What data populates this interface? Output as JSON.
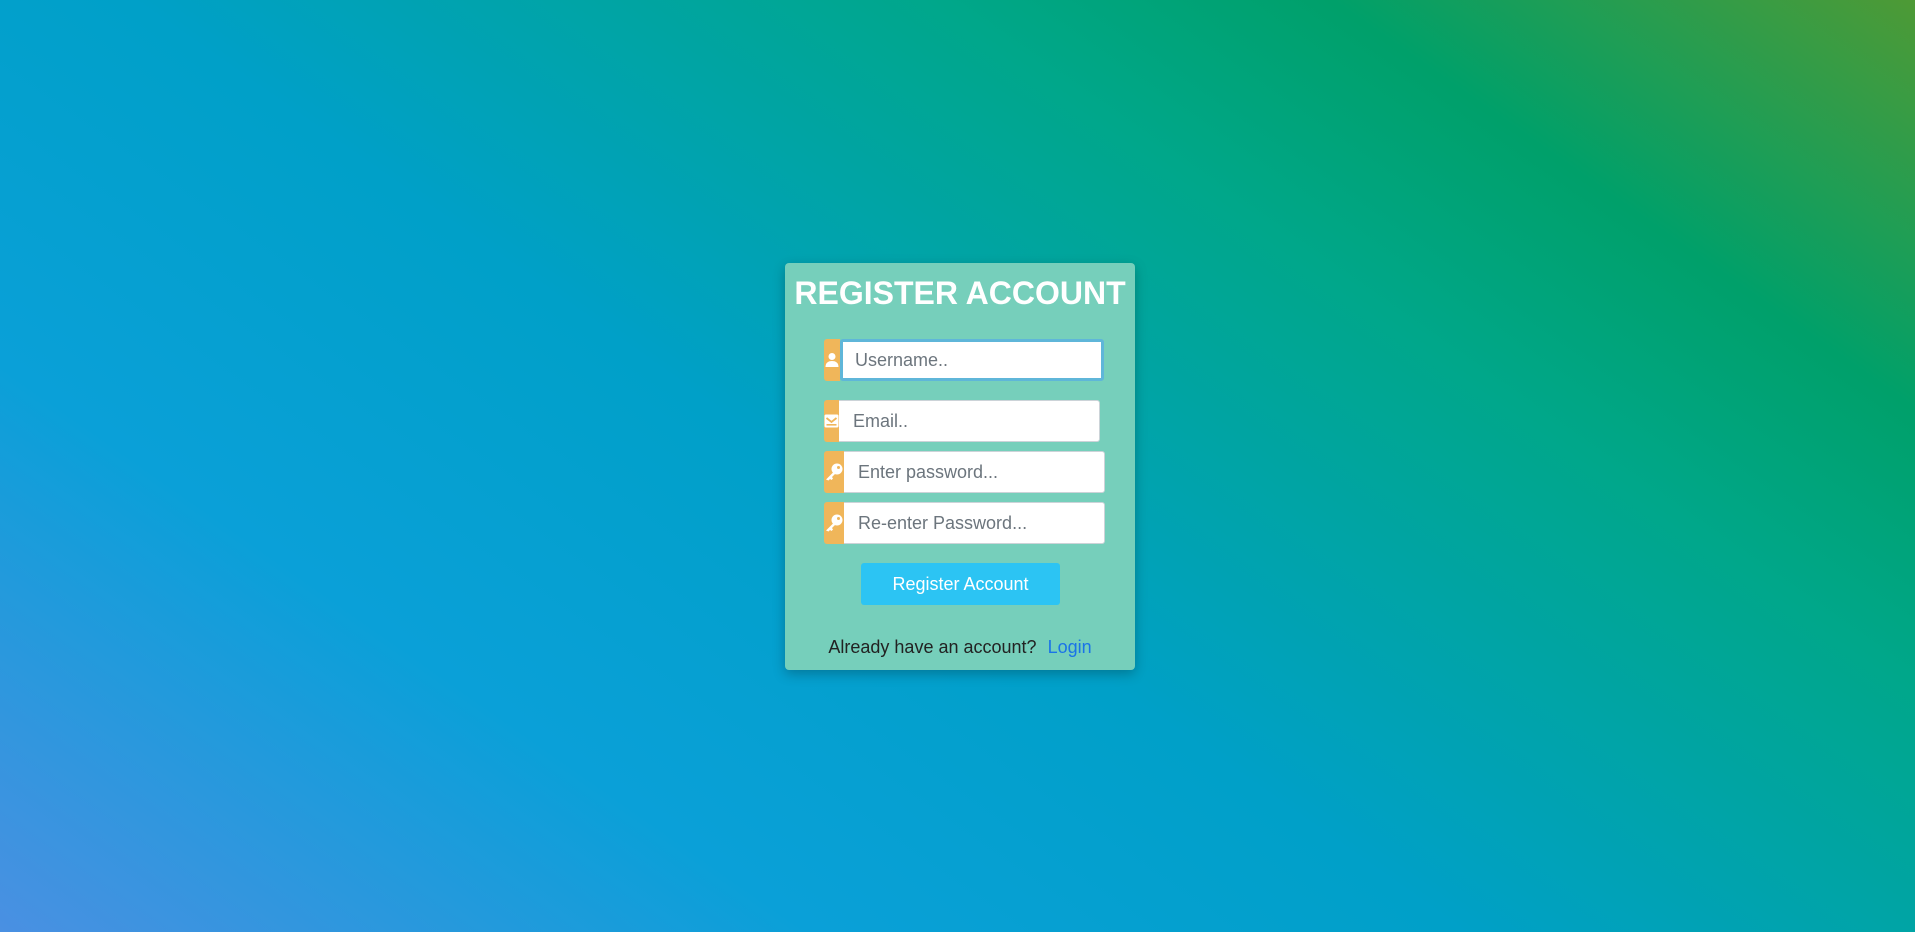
{
  "form": {
    "title": "REGISTER ACCOUNT",
    "username": {
      "placeholder": "Username..",
      "value": "",
      "icon": "user-icon"
    },
    "email": {
      "placeholder": "Email..",
      "value": "",
      "icon": "envelope-icon"
    },
    "password": {
      "placeholder": "Enter password...",
      "value": "",
      "icon": "key-icon"
    },
    "confirm_password": {
      "placeholder": "Re-enter Password...",
      "value": "",
      "icon": "key-icon"
    },
    "submit_label": "Register Account",
    "footer_text": "Already have an account?",
    "login_link": "Login"
  },
  "colors": {
    "card_bg": "#76cfbb",
    "icon_addon": "#f0b65a",
    "button": "#2cc4f3",
    "link": "#1a73e8"
  }
}
